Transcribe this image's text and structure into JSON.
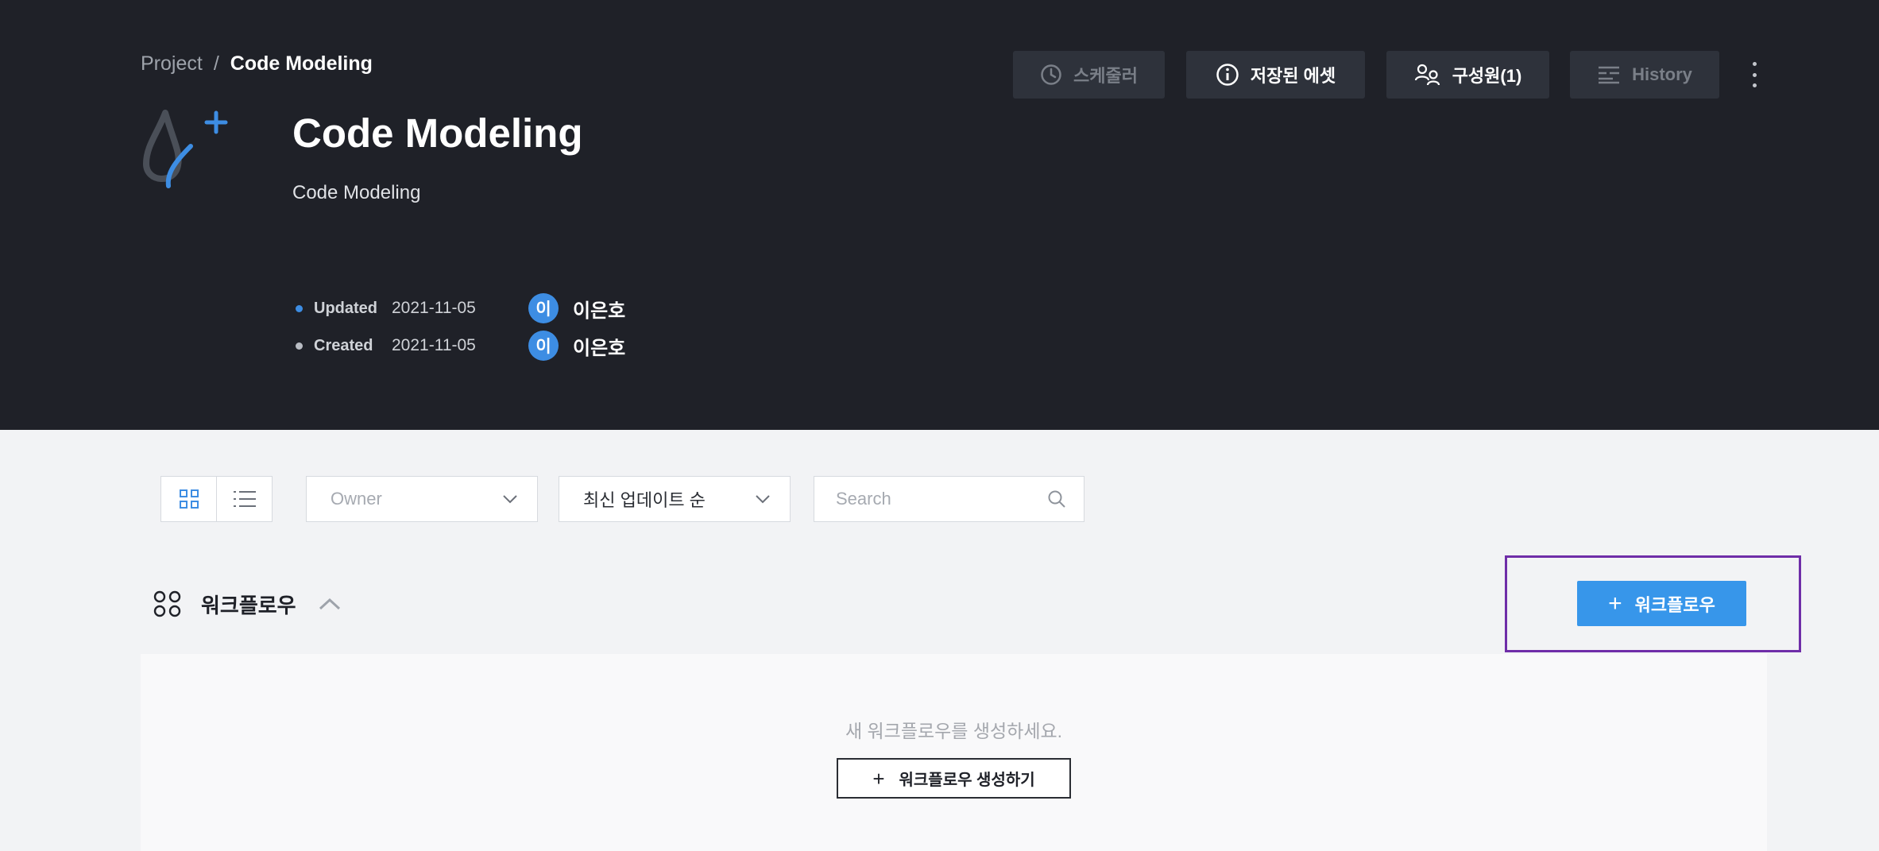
{
  "breadcrumb": {
    "root": "Project",
    "separator": "/",
    "current": "Code Modeling"
  },
  "project": {
    "logo_icon": "drop-sparkle-logo-icon",
    "title": "Code Modeling",
    "description": "Code Modeling",
    "updated": {
      "label": "Updated",
      "date": "2021-11-05",
      "avatar_initial": "이",
      "user": "이은호",
      "dot_color": "#3d8de3"
    },
    "created": {
      "label": "Created",
      "date": "2021-11-05",
      "avatar_initial": "이",
      "user": "이은호",
      "dot_color": "#b8bcc3"
    }
  },
  "header_actions": {
    "scheduler": {
      "label": "스케줄러",
      "icon": "clock-icon",
      "enabled": false
    },
    "saved_assets": {
      "label": "저장된 에셋",
      "icon": "info-icon",
      "enabled": true
    },
    "members": {
      "label": "구성원(1)",
      "icon": "members-icon",
      "enabled": true
    },
    "history": {
      "label": "History",
      "icon": "history-list-icon",
      "enabled": false
    },
    "more": {
      "icon": "more-vertical-icon"
    }
  },
  "toolbar": {
    "view_modes": [
      {
        "name": "grid",
        "icon": "grid-view-icon",
        "active": true
      },
      {
        "name": "list",
        "icon": "list-view-icon",
        "active": false
      }
    ],
    "owner_filter": {
      "placeholder": "Owner",
      "value": ""
    },
    "sort": {
      "value": "최신 업데이트 순"
    },
    "search": {
      "placeholder": "Search",
      "value": ""
    }
  },
  "workflow_section": {
    "title": "워크플로우",
    "icon": "workflow-icon",
    "collapse_icon": "chevron-up-icon",
    "add_button_label": "워크플로우",
    "empty_message": "새 워크플로우를 생성하세요.",
    "create_button_label": "워크플로우 생성하기"
  },
  "colors": {
    "header_bg": "#1f2128",
    "page_bg": "#f2f3f5",
    "accent": "#3796ea",
    "highlight": "#6f2da8"
  }
}
